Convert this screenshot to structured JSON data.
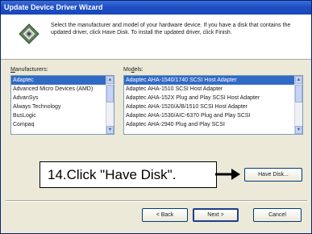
{
  "window": {
    "title": "Update Device Driver Wizard"
  },
  "header": {
    "instructions": "Select the manufacturer and model of your hardware device. If you have a disk that contains the updated driver, click Have Disk. To install the updated driver, click Finish.",
    "icon": "wizard-diamond-icon"
  },
  "manufacturers": {
    "label_prefix": "",
    "label_key": "M",
    "label_rest": "anufacturers:",
    "items": [
      "Adaptec",
      "Advanced Micro Devices (AMD)",
      "AdvanSys",
      "Always Technology",
      "BusLogic",
      "Compaq"
    ],
    "selected_index": 0
  },
  "models": {
    "label_prefix": "Mo",
    "label_key": "d",
    "label_rest": "els:",
    "items": [
      "Adaptec AHA-1540/1740 SCSI Host Adapter",
      "Adaptec AHA-1510 SCSI Host Adapter",
      "Adaptec AHA-152X Plug and Play SCSI Host Adapter",
      "Adaptec AHA-1520/A/B/1510 SCSI Host Adapter",
      "Adaptec AHA-1530/AIC-6370 Plug and Play SCSI",
      "Adaptec AHA-2940 Plug and Play SCSI"
    ],
    "selected_index": 0
  },
  "buttons": {
    "have_disk": "Have Disk...",
    "back": "< Back",
    "next": "Next >",
    "cancel": "Cancel"
  },
  "callout": {
    "text": "14.Click \"Have Disk\"."
  },
  "colors": {
    "title_bar": "#1f4fc4",
    "selection": "#316ac5",
    "face": "#ece9d8"
  }
}
